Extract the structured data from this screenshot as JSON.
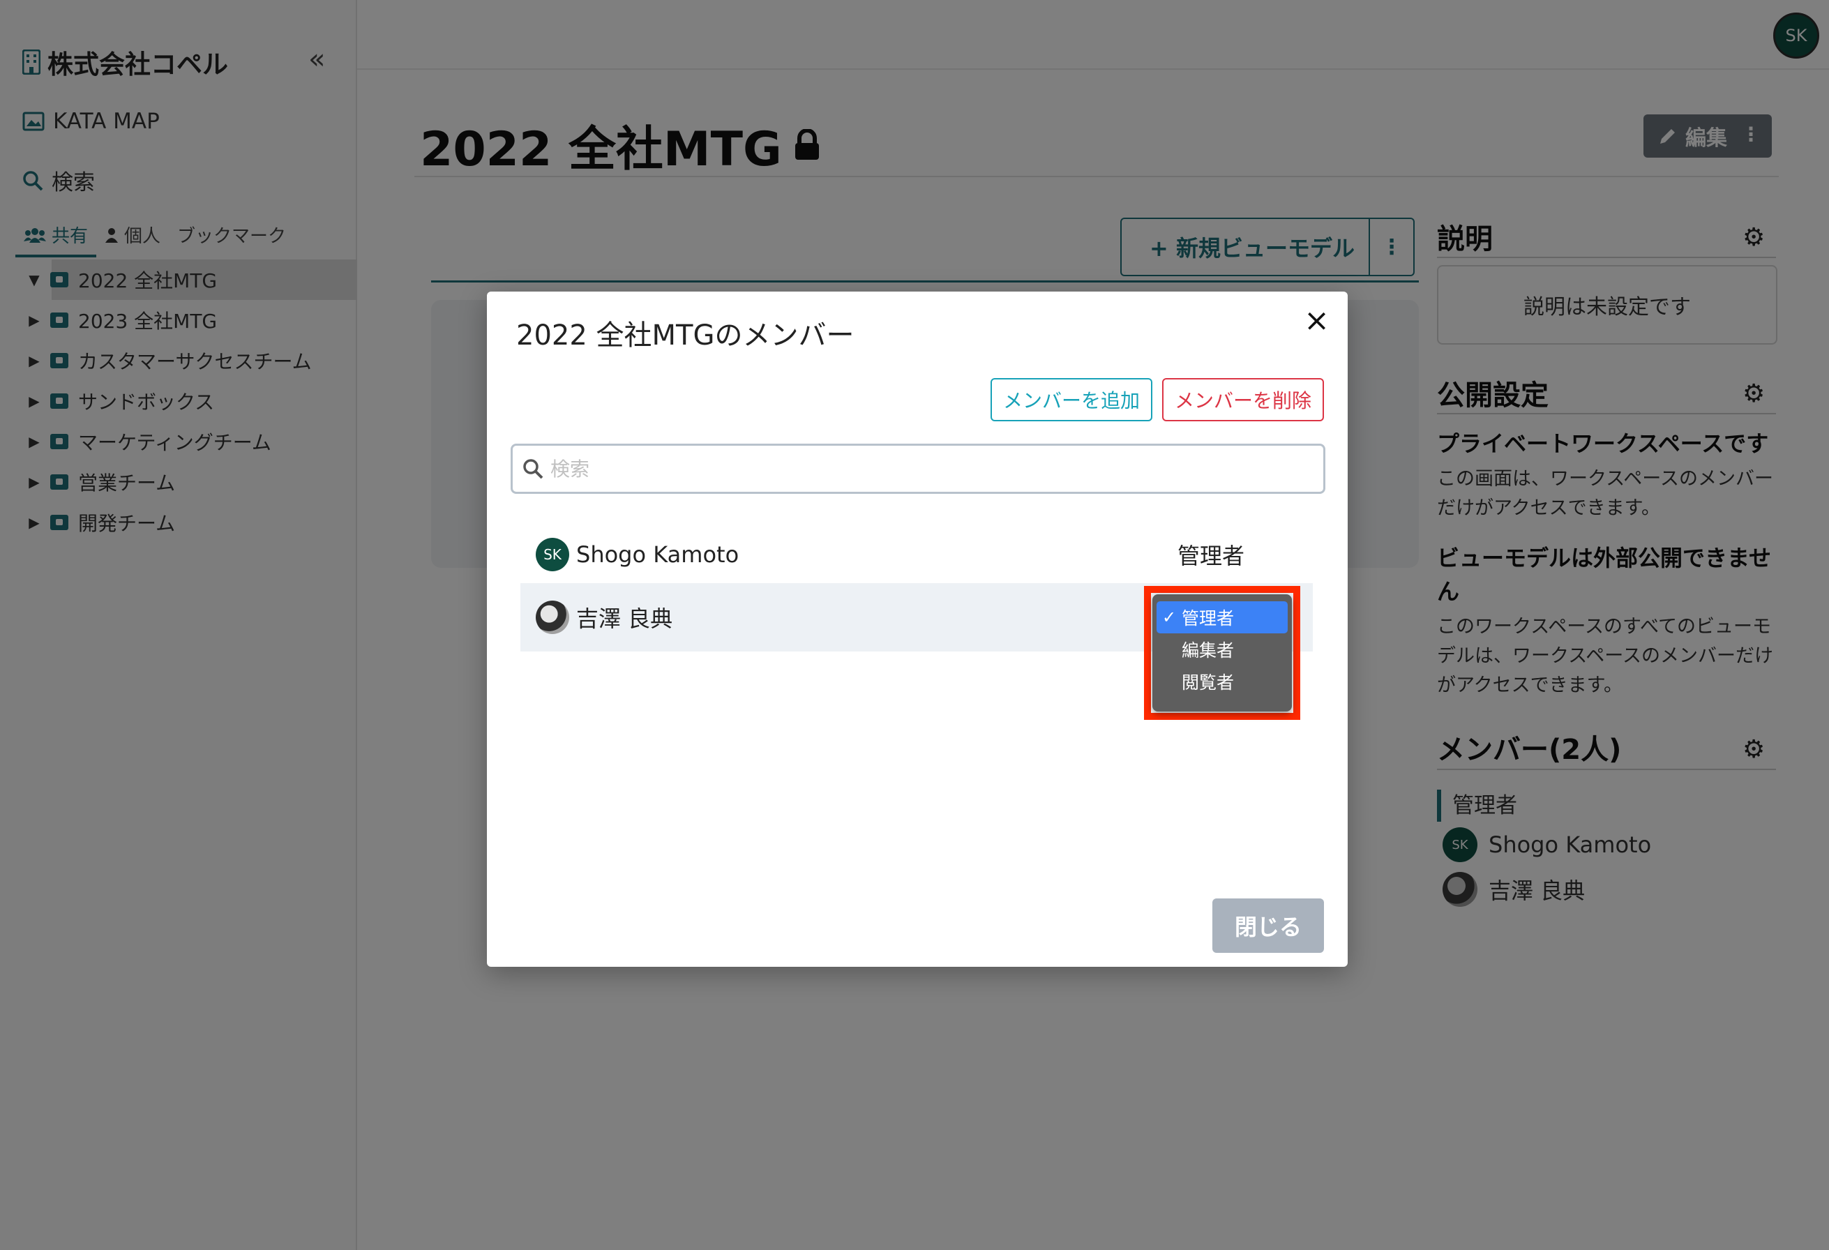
{
  "sidebar": {
    "org_name": "株式会社コペル",
    "collapse": "«",
    "kata_map": "KATA MAP",
    "search": "検索",
    "tabs": [
      "共有",
      "個人",
      "ブックマーク"
    ],
    "tree": [
      "2022 全社MTG",
      "2023 全社MTG",
      "カスタマーサクセスチーム",
      "サンドボックス",
      "マーケティングチーム",
      "営業チーム",
      "開発チーム"
    ]
  },
  "topbar": {
    "avatar": "SK"
  },
  "main": {
    "title": "2022 全社MTG",
    "edit_label": "編集",
    "new_view_model": "新規ビューモデル"
  },
  "right_panel": {
    "description_title": "説明",
    "description_empty": "説明は未設定です",
    "visibility_title": "公開設定",
    "private_ws": "プライベートワークスペースです",
    "private_ws_desc": "この画面は、ワークスペースのメンバーだけがアクセスできます。",
    "vm_private": "ビューモデルは外部公開できません",
    "vm_private_desc": "このワークスペースのすべてのビューモデルは、ワークスペースのメンバーだけがアクセスできます。",
    "members_title": "メンバー(2人)",
    "role_admin": "管理者",
    "members": [
      {
        "initials": "SK",
        "name": "Shogo Kamoto"
      },
      {
        "name": "吉澤 良典"
      }
    ]
  },
  "modal": {
    "title": "2022 全社MTGのメンバー",
    "close_icon": "×",
    "add_member": "メンバーを追加",
    "remove_member": "メンバーを削除",
    "search_placeholder": "検索",
    "members": [
      {
        "initials": "SK",
        "name": "Shogo Kamoto",
        "role": "管理者"
      },
      {
        "name": "吉澤 良典",
        "role": "管理者"
      }
    ],
    "role_options": [
      "管理者",
      "編集者",
      "閲覧者"
    ],
    "selected_role": "管理者",
    "close_button": "閉じる"
  },
  "colors": {
    "accent": "#1f6f78",
    "highlight": "#ff2a00",
    "danger": "#dc3545",
    "info": "#17a2b8",
    "selected": "#3c82f6"
  }
}
